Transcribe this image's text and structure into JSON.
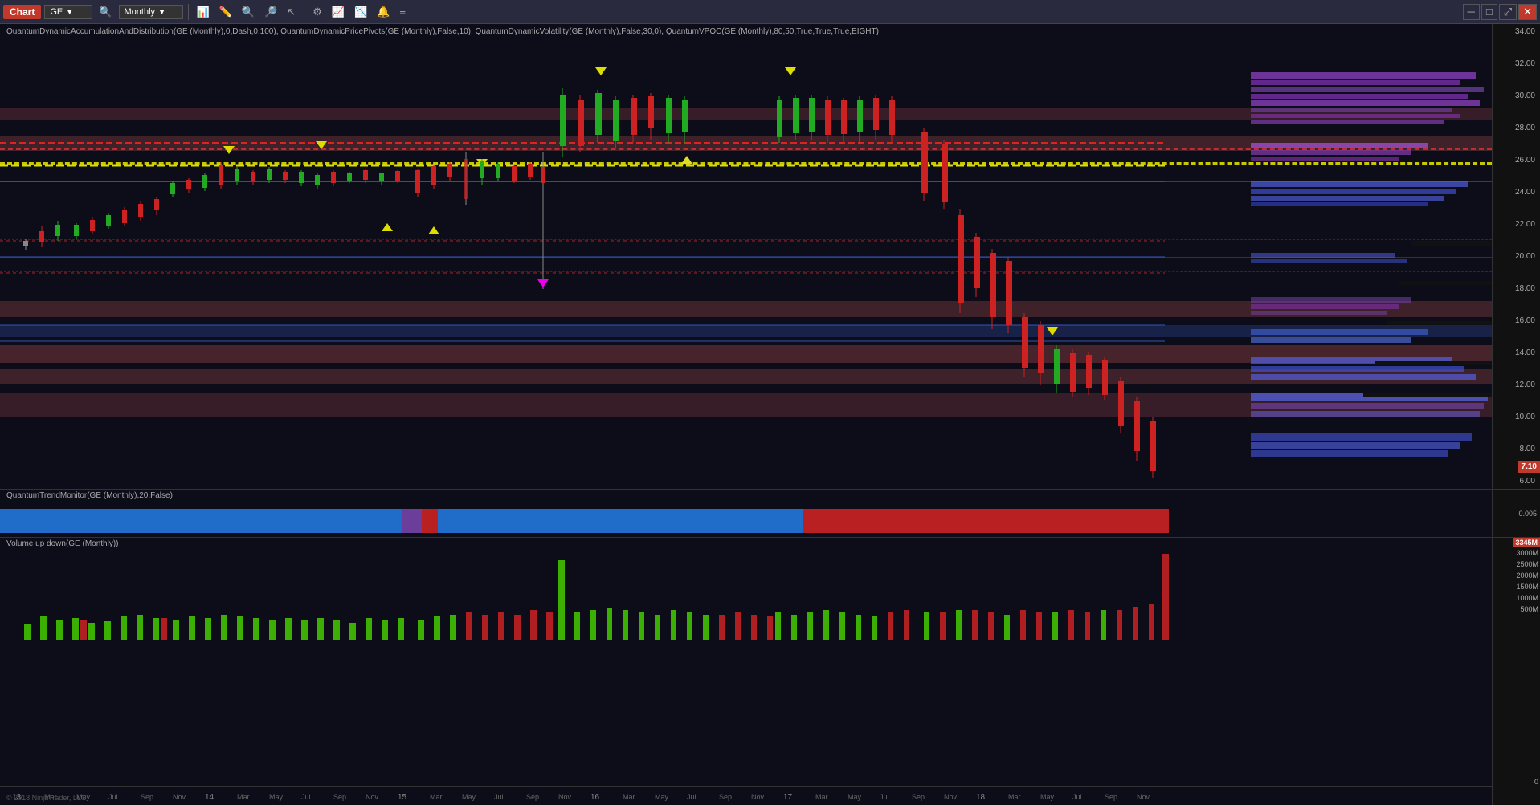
{
  "toolbar": {
    "chart_label": "Chart",
    "symbol": "GE",
    "timeframe": "Monthly",
    "tools": [
      "magnify-icon",
      "crosshair-icon",
      "zoom-out-icon",
      "zoom-in-icon",
      "cursor-icon",
      "bar-chart-icon",
      "rectangle-icon",
      "line-icon",
      "fibonacci-icon",
      "text-icon",
      "settings-icon"
    ]
  },
  "price_panel": {
    "indicator_label": "QuantumDynamicAccumulationAndDistribution(GE (Monthly),0,Dash,0,100), QuantumDynamicPricePivots(GE (Monthly),False,10), QuantumDynamicVolatility(GE (Monthly),False,30,0), QuantumVPOC(GE (Monthly),80,50,True,True,True,EIGHT)",
    "price_levels": [
      "34.00",
      "32.00",
      "30.00",
      "28.00",
      "26.00",
      "24.00",
      "22.00",
      "20.00",
      "18.00",
      "16.00",
      "14.00",
      "12.00",
      "10.00",
      "8.00",
      "6.00"
    ],
    "current_price": "7.10"
  },
  "trend_panel": {
    "label": "QuantumTrendMonitor(GE (Monthly),20,False)",
    "value_label": "0.005"
  },
  "volume_panel": {
    "label": "Volume up down(GE (Monthly))",
    "levels": [
      "3000M",
      "2500M",
      "2000M",
      "1500M",
      "1000M",
      "500M",
      "0"
    ],
    "current_volume": "3345M"
  },
  "date_labels": [
    "13",
    "Mar",
    "May",
    "Jul",
    "Sep",
    "Nov",
    "14",
    "Mar",
    "May",
    "Jul",
    "Sep",
    "Nov",
    "15",
    "Mar",
    "May",
    "Jul",
    "Sep",
    "Nov",
    "16",
    "Mar",
    "May",
    "Jul",
    "Sep",
    "Nov",
    "17",
    "Mar",
    "May",
    "Jul",
    "Sep",
    "Nov",
    "18",
    "Mar",
    "May",
    "Jul",
    "Sep",
    "Nov"
  ],
  "footer": "© 2018 NinjaTrader, LLC",
  "colors": {
    "bull_candle": "#22aa22",
    "bear_candle": "#cc2222",
    "vpoc_purple": "#7744aa",
    "vpoc_blue": "#4466cc",
    "trend_blue": "#2277dd",
    "trend_red": "#cc2222",
    "dashed_red": "#dd2222",
    "dashed_yellow": "#dddd00",
    "dashed_blue": "#2244dd",
    "background": "#0d0d1a",
    "axis_bg": "#111111"
  }
}
